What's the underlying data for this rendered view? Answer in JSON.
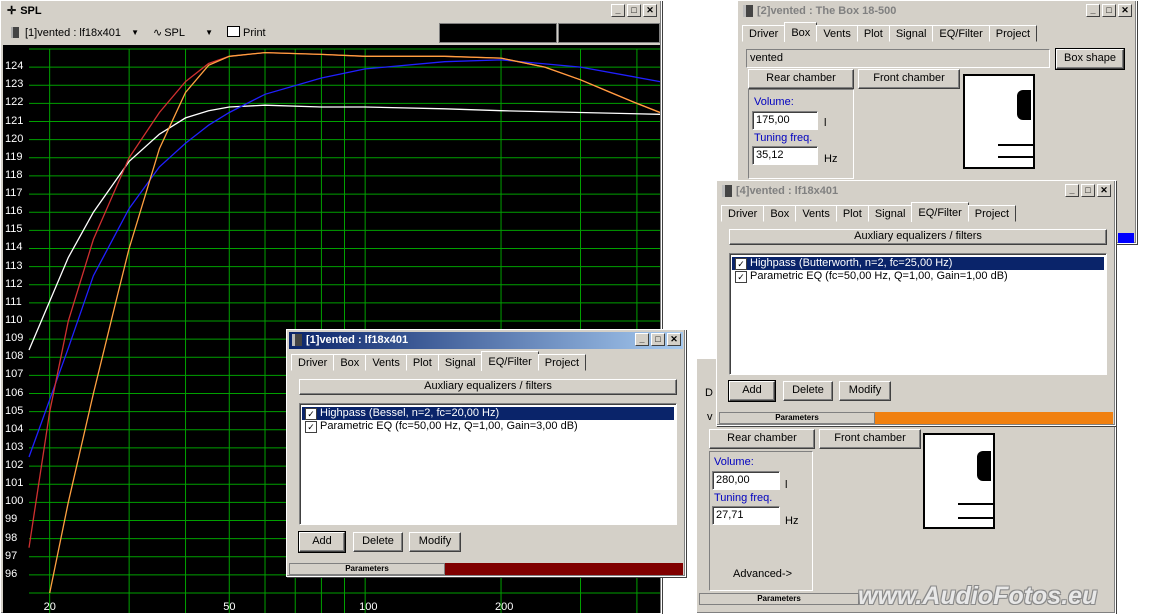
{
  "spl_window": {
    "title": "SPL",
    "project_select": "[1]vented : lf18x401",
    "view_select": "SPL",
    "print_label": "Print",
    "y_ticks": [
      "124",
      "123",
      "122",
      "121",
      "120",
      "119",
      "118",
      "117",
      "116",
      "115",
      "114",
      "113",
      "112",
      "111",
      "110",
      "109",
      "108",
      "107",
      "106",
      "105",
      "104",
      "103",
      "102",
      "101",
      "100",
      "99",
      "98",
      "97",
      "96"
    ],
    "x_ticks": [
      "20",
      "50",
      "100",
      "200"
    ]
  },
  "chart_data": {
    "type": "line",
    "xlabel": "",
    "ylabel": "",
    "x_scale": "log",
    "xlim": [
      18,
      450
    ],
    "ylim": [
      95,
      125
    ],
    "grid": true,
    "background": "#000000",
    "grid_color": "#00a000",
    "series": [
      {
        "color": "#ffffff",
        "x": [
          18,
          22,
          25,
          30,
          35,
          40,
          45,
          50,
          60,
          80,
          100,
          150,
          200,
          300,
          450
        ],
        "y": [
          108.4,
          113.5,
          116,
          118.8,
          120.3,
          121.2,
          121.6,
          121.8,
          121.9,
          121.8,
          121.8,
          121.7,
          121.6,
          121.5,
          121.4
        ]
      },
      {
        "color": "#2020ff",
        "x": [
          18,
          22,
          25,
          30,
          35,
          40,
          45,
          50,
          60,
          80,
          100,
          150,
          200,
          300,
          450
        ],
        "y": [
          102.5,
          108.5,
          112.5,
          116.2,
          118.5,
          119.8,
          120.8,
          121.5,
          122.5,
          123.4,
          123.9,
          124.3,
          124.4,
          124.0,
          123.2
        ]
      },
      {
        "color": "#d03030",
        "x": [
          18,
          20,
          22,
          25,
          30,
          35,
          40,
          45,
          50,
          60,
          80,
          100,
          150,
          200,
          250,
          300,
          350,
          400,
          450
        ],
        "y": [
          97.5,
          105,
          110,
          114.5,
          119,
          121.5,
          123.2,
          124.2,
          124.6,
          124.8,
          124.7,
          124.6,
          124.6,
          124.5,
          124.0,
          123.3,
          122.6,
          122.0,
          121.5
        ]
      },
      {
        "color": "#ffa040",
        "x": [
          20,
          22,
          25,
          28,
          30,
          35,
          40,
          45,
          50,
          60,
          80,
          100,
          150,
          200,
          250,
          300,
          350,
          400,
          450
        ],
        "y": [
          95,
          100,
          106,
          111,
          114,
          119.5,
          122.6,
          124.1,
          124.6,
          124.8,
          124.7,
          124.6,
          124.6,
          124.5,
          124.0,
          123.3,
          122.6,
          122.0,
          121.5
        ]
      }
    ]
  },
  "box_win2": {
    "title": "[2]vented : The Box 18-500",
    "tabs": [
      "Driver",
      "Box",
      "Vents",
      "Plot",
      "Signal",
      "EQ/Filter",
      "Project"
    ],
    "box_name": "vented",
    "box_shape_label": "Box shape",
    "rear_chamber": "Rear chamber",
    "front_chamber": "Front chamber",
    "volume_label": "Volume:",
    "volume_value": "175,00",
    "volume_unit": "l",
    "tuning_label": "Tuning freq.",
    "tuning_value": "35,12",
    "tuning_unit": "Hz"
  },
  "eq_win4": {
    "title": "[4]vented : lf18x401",
    "tabs": [
      "Driver",
      "Box",
      "Vents",
      "Plot",
      "Signal",
      "EQ/Filter",
      "Project"
    ],
    "header": "Auxliary equalizers / filters",
    "items": [
      "Highpass (Butterworth, n=2, fc=25,00 Hz)",
      "Parametric EQ (fc=50,00 Hz, Q=1,00, Gain=1,00 dB)"
    ],
    "add": "Add",
    "delete": "Delete",
    "modify": "Modify",
    "params": "Parameters",
    "progress_color": "#f08010"
  },
  "box_win_back": {
    "tab_partial": "D",
    "name_partial": "v",
    "rear_chamber": "Rear chamber",
    "front_chamber": "Front chamber",
    "volume_label": "Volume:",
    "volume_value": "280,00",
    "volume_unit": "l",
    "tuning_label": "Tuning freq.",
    "tuning_value": "27,71",
    "tuning_unit": "Hz",
    "advanced": "Advanced->",
    "params": "Parameters"
  },
  "eq_win1": {
    "title": "[1]vented : lf18x401",
    "tabs": [
      "Driver",
      "Box",
      "Vents",
      "Plot",
      "Signal",
      "EQ/Filter",
      "Project"
    ],
    "header": "Auxliary equalizers / filters",
    "items": [
      "Highpass (Bessel, n=2, fc=20,00 Hz)",
      "Parametric EQ (fc=50,00 Hz, Q=1,00, Gain=3,00 dB)"
    ],
    "add": "Add",
    "delete": "Delete",
    "modify": "Modify",
    "params": "Parameters",
    "progress_color": "#800000"
  },
  "watermark": "www.AudioFotos.eu",
  "title_buttons": {
    "min": "_",
    "max": "□",
    "close": "✕"
  }
}
